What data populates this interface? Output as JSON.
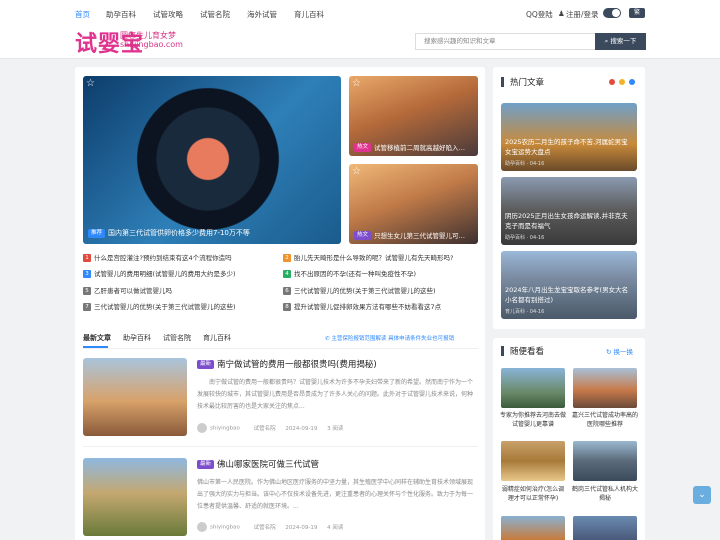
{
  "nav": {
    "items": [
      "首页",
      "助孕百科",
      "试管攻略",
      "试管名院",
      "海外试管",
      "育儿百科"
    ],
    "qq_login": "QQ登陆",
    "register_login": "注册/登录",
    "lang": "繁"
  },
  "header": {
    "logo": "试婴宝",
    "slogan": "圆您生儿育女梦",
    "domain": "shiyingbao.com",
    "search_placeholder": "搜索感兴趣的知识和文章",
    "search_button": "搜索一下"
  },
  "featured": {
    "main": {
      "badge": "推荐",
      "title": "国内第三代试管供卵价格多少费用7-10万不等"
    },
    "side1": {
      "badge": "热文",
      "title": "试管移植前二周就高越好陷入…"
    },
    "side2": {
      "badge": "热文",
      "title": "只想生女儿第三代试管婴儿可…"
    }
  },
  "quick_links": [
    {
      "n": "1",
      "text": "什么是宫腔灌注?预约到结束有这4个流程你造吗"
    },
    {
      "n": "2",
      "text": "胎儿先天畸形是什么导致的呢？试管婴儿有先天畸形吗?"
    },
    {
      "n": "3",
      "text": "试管婴儿的费用明细(试管婴儿的费用大约是多少)"
    },
    {
      "n": "4",
      "text": "找不出原因的不孕(还有一种叫免疫性不孕)"
    },
    {
      "n": "5",
      "text": "乙肝患者可以做试管婴儿吗"
    },
    {
      "n": "6",
      "text": "三代试管婴儿的优势(关于第三代试管婴儿的这些)"
    },
    {
      "n": "7",
      "text": "三代试管婴儿的优势(关于第三代试管婴儿的这些)"
    },
    {
      "n": "8",
      "text": "提升试管婴儿促排卵效果方法有哪些不妨看看这7点"
    }
  ],
  "tabs": [
    "最新文章",
    "助孕百科",
    "试管名院",
    "育儿百科"
  ],
  "notice": "主营保险报销范围解读 具体申请条件失业也可报销",
  "posts": [
    {
      "tag": "最新",
      "title": "南宁做试管的费用一般都很贵吗(费用揭秘)",
      "excerpt": "南宁做试管的费用一般都很贵吗？试管婴儿技术为许多不孕夫妇带来了新的希望。然而南宁作为一个发展较快的城市，其试管婴儿费用是否昂贵成为了许多人关心的问题。此外对于试管婴儿技术来说，何种技术最比较厉害的也是大家关注的焦点...",
      "author": "shiyingbao",
      "category": "试管名院",
      "date": "2024-09-19",
      "views": "3 阅读"
    },
    {
      "tag": "最新",
      "title": "佛山哪家医院可做三代试管",
      "excerpt": "佛山市第一人民医院。作为佛山地区医疗服务的中坚力量，其生殖医学中心同样在辅助生育技术领域展现出了强大的实力与担当。该中心不仅技术设备先进，更注重患者的心理关怀与个性化服务。致力于为每一位患者提供温馨、舒适的就医环境。...",
      "author": "shiyingbao",
      "category": "试管名院",
      "date": "2024-09-19",
      "views": "4 阅读"
    }
  ],
  "sidebar": {
    "hot_title": "热门文章",
    "hot": [
      {
        "text": "2025农历二月生的孩子命不苦,河属蛇男宝女宝运势大盘点",
        "meta": "助孕百科 · 04-16"
      },
      {
        "text": "阴历2025正月出生女孩命运解读,并非克夫克子而是有福气",
        "meta": "助孕百科 · 04-16"
      },
      {
        "text": "2024年八月出生龙宝宝取名参考(男女大名小名都有别搭过)",
        "meta": "育儿百科 · 04-16"
      }
    ],
    "random_title": "随便看看",
    "refresh": "换一换",
    "grid": [
      {
        "text": "专家为你推荐去河南去做试管婴儿更靠谱"
      },
      {
        "text": "嘉兴三代试管成功率高的医院哪些推荐"
      },
      {
        "text": "弱精症如何治疗(怎么调理才可以正常怀孕)"
      },
      {
        "text": "鹤岗三代试管私人机构大揭秘"
      }
    ]
  },
  "colors": {
    "accent": "#2f89fc",
    "pink": "#e0338f",
    "dark": "#3a4a5c",
    "purple": "#7c4dcc"
  }
}
